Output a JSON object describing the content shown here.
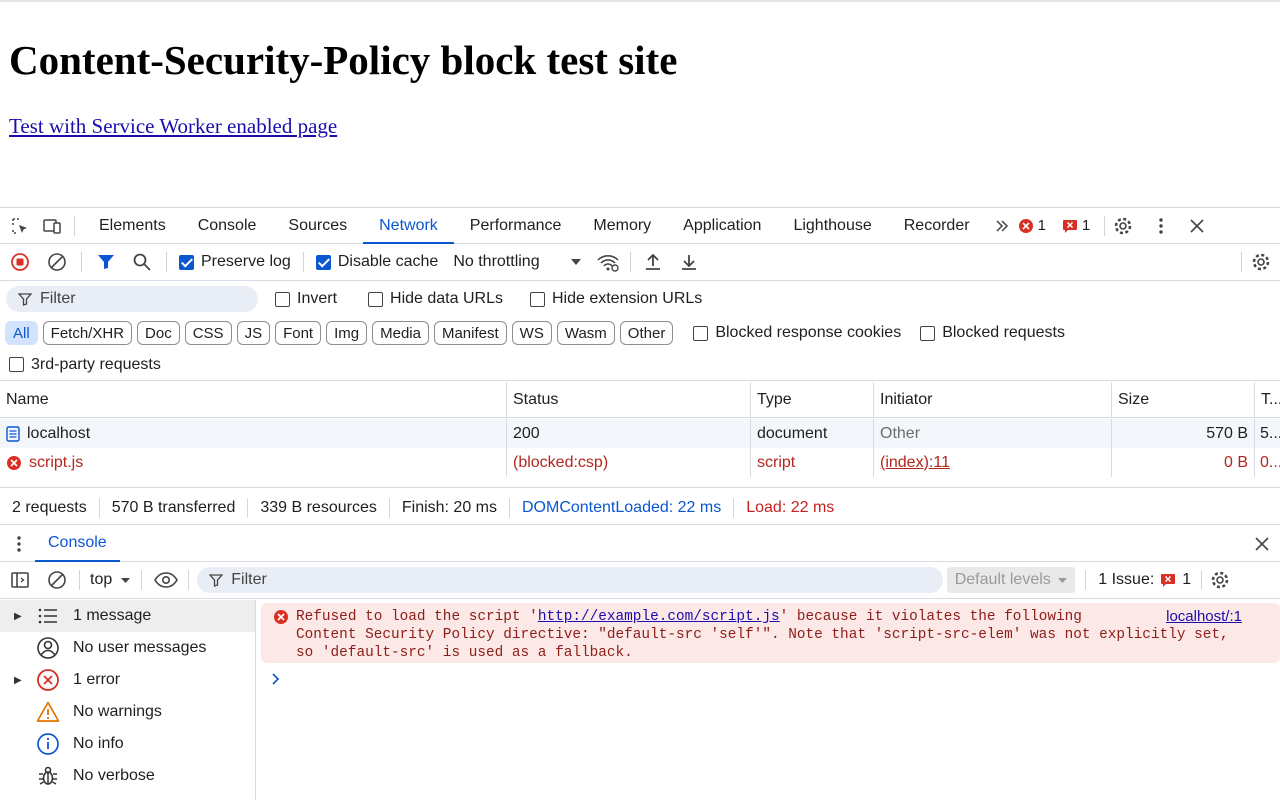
{
  "page": {
    "heading": "Content-Security-Policy block test site",
    "link": "Test with Service Worker enabled page"
  },
  "devtools": {
    "tabs": [
      "Elements",
      "Console",
      "Sources",
      "Network",
      "Performance",
      "Memory",
      "Application",
      "Lighthouse",
      "Recorder"
    ],
    "active_tab": "Network",
    "error_count": "1",
    "issue_count": "1",
    "network_toolbar": {
      "preserve_log": "Preserve log",
      "disable_cache": "Disable cache",
      "throttling": "No throttling"
    },
    "filter": {
      "placeholder": "Filter",
      "invert": "Invert",
      "hide_data_urls": "Hide data URLs",
      "hide_extension_urls": "Hide extension URLs"
    },
    "type_chips": [
      "All",
      "Fetch/XHR",
      "Doc",
      "CSS",
      "JS",
      "Font",
      "Img",
      "Media",
      "Manifest",
      "WS",
      "Wasm",
      "Other"
    ],
    "blocked_response_cookies": "Blocked response cookies",
    "blocked_requests": "Blocked requests",
    "third_party": "3rd-party requests",
    "table": {
      "columns": [
        "Name",
        "Status",
        "Type",
        "Initiator",
        "Size",
        "T..."
      ],
      "rows": [
        {
          "name": "localhost",
          "status": "200",
          "type": "document",
          "initiator": "Other",
          "size": "570 B",
          "time": "5..."
        },
        {
          "name": "script.js",
          "status": "(blocked:csp)",
          "type": "script",
          "initiator": "(index):11",
          "size": "0 B",
          "time": "0..."
        }
      ]
    },
    "summary": {
      "requests": "2 requests",
      "transferred": "570 B transferred",
      "resources": "339 B resources",
      "finish": "Finish: 20 ms",
      "dcl": "DOMContentLoaded: 22 ms",
      "load": "Load: 22 ms"
    },
    "console": {
      "tab": "Console",
      "context": "top",
      "filter_placeholder": "Filter",
      "levels": "Default levels",
      "issues_label": "1 Issue:",
      "issues_count": "1",
      "sidebar": [
        {
          "label": "1 message",
          "icon": "list-icon"
        },
        {
          "label": "No user messages",
          "icon": "user-icon"
        },
        {
          "label": "1 error",
          "icon": "error-icon"
        },
        {
          "label": "No warnings",
          "icon": "warning-icon"
        },
        {
          "label": "No info",
          "icon": "info-icon"
        },
        {
          "label": "No verbose",
          "icon": "bug-icon"
        }
      ],
      "message": {
        "line1_pre": "Refused to load the script '",
        "line1_link": "http://example.com/script.js",
        "line1_post": "' because it violates the following",
        "line2": "Content Security Policy directive: \"default-src 'self'\". Note that 'script-src-elem' was not explicitly set,",
        "line3": "so 'default-src' is used as a fallback.",
        "source": "localhost/:1"
      }
    }
  }
}
